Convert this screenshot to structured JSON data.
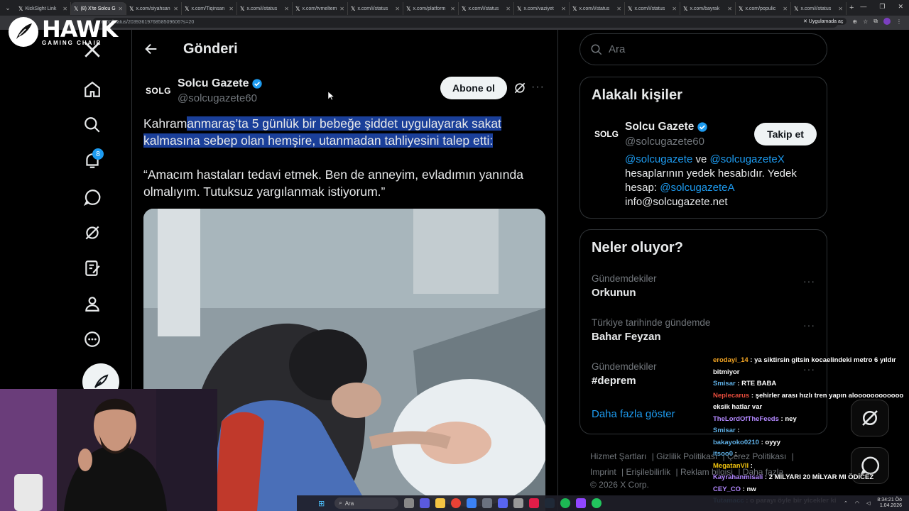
{
  "browser": {
    "tabs": [
      {
        "label": "KickSight Link"
      },
      {
        "label": "(8) X'te Solcu G",
        "active": true
      },
      {
        "label": "x.com/siyahsan"
      },
      {
        "label": "x.com/Tiqinsan"
      },
      {
        "label": "x.com/i/status"
      },
      {
        "label": "x.com/tvmeltem"
      },
      {
        "label": "x.com/i/status"
      },
      {
        "label": "x.com/platform"
      },
      {
        "label": "x.com/i/status"
      },
      {
        "label": "x.com/vaziyet"
      },
      {
        "label": "x.com/i/status"
      },
      {
        "label": "x.com/i/status"
      },
      {
        "label": "x.com/bayrak"
      },
      {
        "label": "x.com/populic"
      },
      {
        "label": "x.com/i/status"
      }
    ],
    "url": "...ne60/status/2039361976858509606?s=20",
    "app_mode_label": "Uygulamada aç"
  },
  "overlay_logo": {
    "name": "HAWK",
    "sub": "GAMING CHAIR"
  },
  "nav": {
    "notification_count": "8"
  },
  "post": {
    "page_title": "Gönderi",
    "author": {
      "logo_text": "SOLG",
      "name": "Solcu Gazete",
      "handle": "@solcugazete60"
    },
    "subscribe_label": "Abone ol",
    "text_plain": "Kahram",
    "text_highlighted": "anmaraş’ta 5 günlük bir bebeğe şiddet uygulayarak sakat kalmasına sebep olan hemşire, utanmadan tahliyesini talep etti:",
    "quote": "“Amacım hastaları tedavi etmek. Ben de anneyim, evladımın yanında olmalıyım. Tutuksuz yargılanmak istiyorum.”"
  },
  "sidebar": {
    "search_placeholder": "Ara",
    "relevant": {
      "title": "Alakalı kişiler",
      "logo_text": "SOLG",
      "name": "Solcu Gazete",
      "handle": "@solcugazete60",
      "follow_label": "Takip et",
      "bio_link1": "@solcugazete",
      "bio_and": " ve ",
      "bio_link2": "@solcugazeteX",
      "bio_mid": " hesaplarının yedek hesabıdır. Yedek hesap: ",
      "bio_link3": "@solcugazeteA",
      "bio_email": "info@solcugazete.net"
    },
    "trends": {
      "title": "Neler oluyor?",
      "items": [
        {
          "label": "Gündemdekiler",
          "name": "Orkunun"
        },
        {
          "label": "Türkiye tarihinde gündemde",
          "name": "Bahar Feyzan"
        },
        {
          "label": "Gündemdekiler",
          "name": "#deprem"
        }
      ],
      "show_more": "Daha fazla göster"
    },
    "footer": {
      "links": [
        "Hizmet Şartları",
        "Gizlilik Politikası",
        "Çerez Politikası",
        "Imprint",
        "Erişilebilirlik",
        "Reklam bilgisi",
        "Daha fazla ..."
      ],
      "copyright": "© 2026 X Corp."
    }
  },
  "chat": [
    {
      "user": "erodayi_14",
      "color": "#f5a623",
      "text": "ya siktirsin gitsin kocaelindeki metro 6 yıldır bitmiyor"
    },
    {
      "user": "Smisar",
      "color": "#5dade2",
      "text": "RTE BABA"
    },
    {
      "user": "Neplecarus",
      "color": "#e74c3c",
      "text": "şehirler arası hızlı tren yapın aloooooooooooo eksik hatlar var"
    },
    {
      "user": "TheLordOfTheFeeds",
      "color": "#b388ff",
      "text": "ney"
    },
    {
      "user": "Smisar",
      "color": "#5dade2",
      "text": ""
    },
    {
      "user": "bakayoko0210",
      "color": "#5dade2",
      "text": "oyyy"
    },
    {
      "user": "itsoo0",
      "color": "#5dade2",
      "text": ""
    },
    {
      "user": "MegatanVII",
      "color": "#f1c40f",
      "text": ""
    },
    {
      "user": "Kayrahanmisali",
      "color": "#b388ff",
      "text": "2 MİLYARI 20 MİLYAR MI ÖDİCEZ"
    },
    {
      "user": "CEY_CO",
      "color": "#b388ff",
      "text": "nw"
    },
    {
      "user": "Tutamacc",
      "color": "#5dade2",
      "text": "o parayı öyle bir yicekler ki"
    }
  ],
  "taskbar": {
    "search_label": "Ara",
    "time": "8:34:21 Öö",
    "date": "1.04.2026"
  },
  "colors": {
    "accent": "#1d9bf0",
    "highlight": "#1a3f99",
    "background": "#000000"
  }
}
